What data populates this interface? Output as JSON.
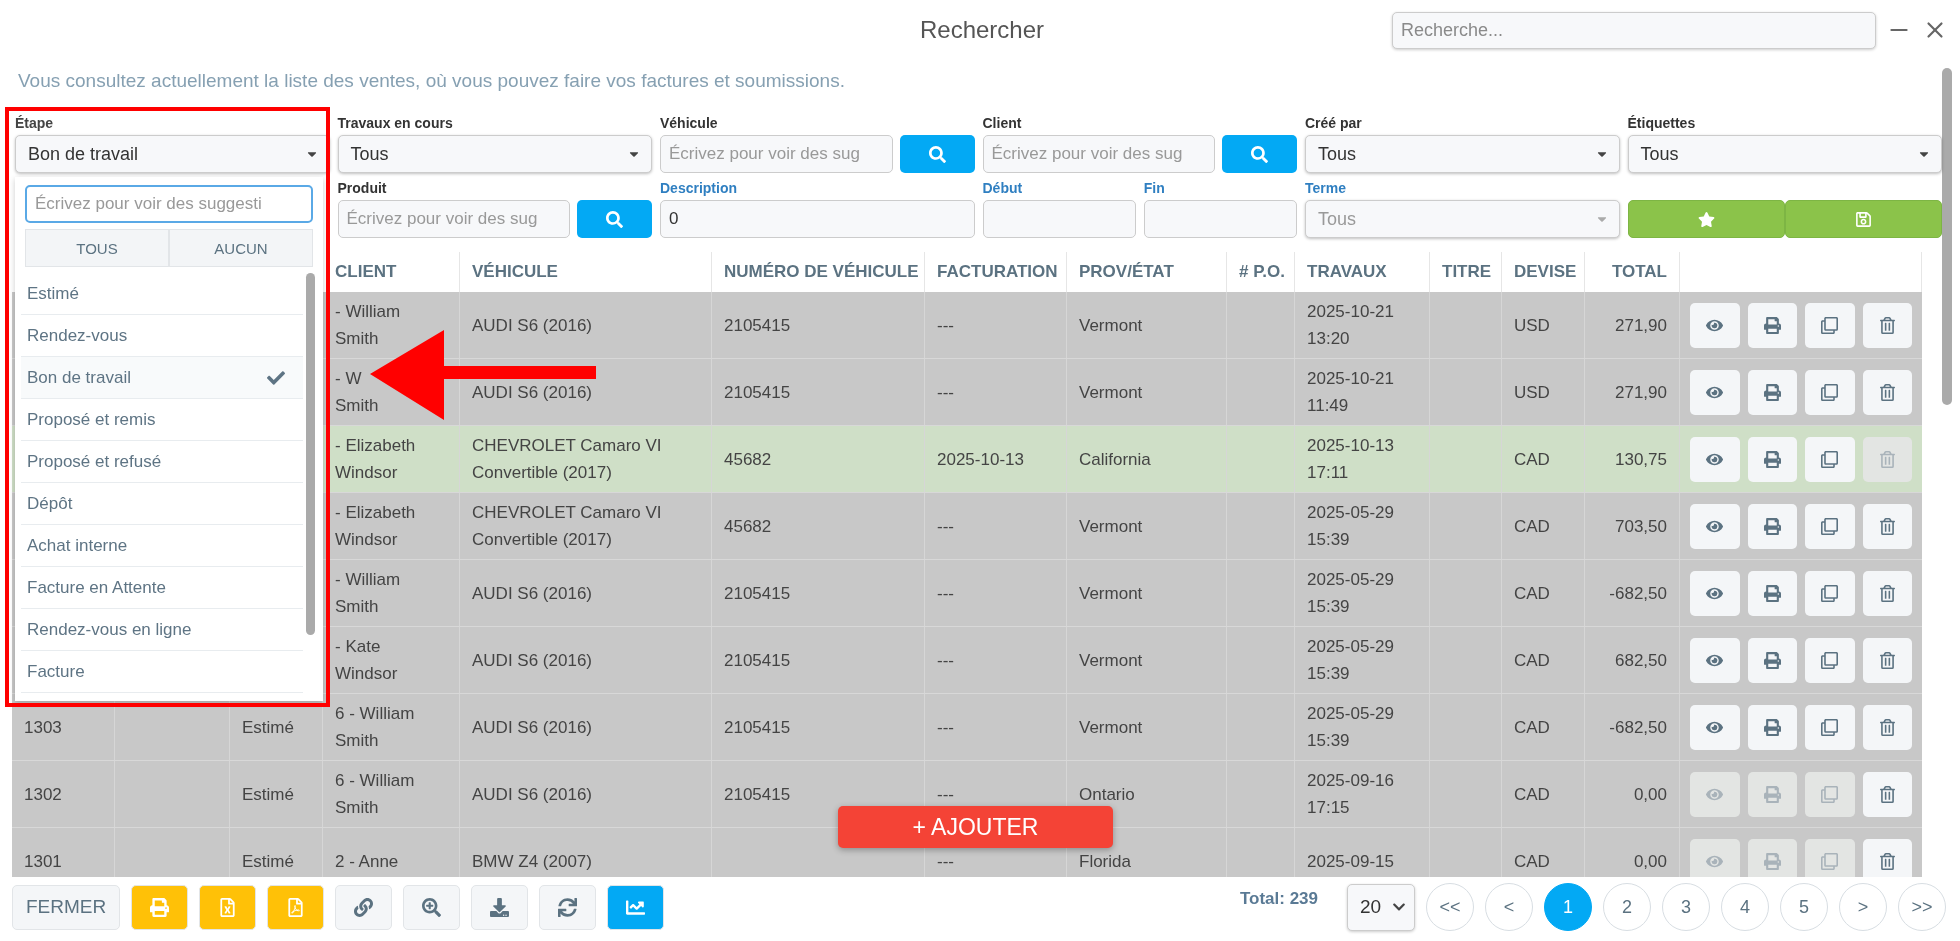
{
  "window": {
    "title": "Rechercher",
    "search": {
      "placeholder": "Recherche..."
    }
  },
  "intro": "Vous consultez actuellement la liste des ventes, où vous pouvez faire vos factures et soumissions.",
  "stage": {
    "label": "Étape",
    "value": "Bon de travail",
    "expanded": true,
    "search_placeholder": "Écrivez pour voir des suggesti",
    "buttons": [
      "TOUS",
      "AUCUN"
    ],
    "options": [
      {
        "label": "Estimé",
        "selected": false
      },
      {
        "label": "Rendez-vous",
        "selected": false
      },
      {
        "label": "Bon de travail",
        "selected": true
      },
      {
        "label": "Proposé et remis",
        "selected": false
      },
      {
        "label": "Proposé et refusé",
        "selected": false
      },
      {
        "label": "Dépôt",
        "selected": false
      },
      {
        "label": "Achat interne",
        "selected": false
      },
      {
        "label": "Facture en Attente",
        "selected": false
      },
      {
        "label": "Rendez-vous en ligne",
        "selected": false
      },
      {
        "label": "Facture",
        "selected": false
      }
    ]
  },
  "filters": [
    [
      {
        "kind": "select",
        "label": "Travaux en cours",
        "value": "Tous",
        "disabled": false,
        "color": "#333333"
      },
      {
        "kind": "search",
        "label": "Véhicule",
        "placeholder": "Écrivez pour voir des sug",
        "color": "#333333"
      },
      {
        "kind": "search",
        "label": "Client",
        "placeholder": "Écrivez pour voir des sug",
        "color": "#333333"
      },
      {
        "kind": "select",
        "label": "Créé par",
        "value": "Tous",
        "disabled": false,
        "color": "#333333"
      },
      {
        "kind": "select",
        "label": "Étiquettes",
        "value": "Tous",
        "disabled": false,
        "color": "#333333"
      }
    ],
    [
      {
        "kind": "search",
        "label": "Produit",
        "placeholder": "Écrivez pour voir des sug",
        "color": "#333333"
      },
      {
        "kind": "text",
        "label": "Description",
        "value": "0",
        "color": "#2f7fc1"
      },
      {
        "kind": "date",
        "label": "Début",
        "color": "#2f7fc1"
      },
      {
        "kind": "date",
        "label": "Fin",
        "color": "#2f7fc1"
      },
      {
        "kind": "select",
        "label": "Terme",
        "value": "Tous",
        "disabled": true,
        "color": "#2f7fc1"
      },
      {
        "kind": "button-pair"
      }
    ]
  ],
  "table": {
    "columns": [
      "CLIENT",
      "VÉHICULE",
      "NUMÉRO DE VÉHICULE",
      "FACTURATION",
      "PROV/ÉTAT",
      "# P.O.",
      "TRAVAUX",
      "TITRE",
      "DEVISE",
      "TOTAL"
    ],
    "rows": [
      {
        "client": [
          "- William",
          "Smith"
        ],
        "vehicle": "AUDI S6 (2016)",
        "vehicle_number": "2105415",
        "billing": "---",
        "province": "Vermont",
        "work": [
          "2025-10-21",
          "13:20"
        ],
        "currency": "USD",
        "total": "271,90",
        "highlighted": false,
        "actions": [
          {
            "kind": "view",
            "disabled": false
          },
          {
            "kind": "print",
            "disabled": false
          },
          {
            "kind": "copy",
            "disabled": false
          },
          {
            "kind": "delete",
            "disabled": false
          }
        ]
      },
      {
        "client": [
          "- W",
          "Smith"
        ],
        "vehicle": "AUDI S6 (2016)",
        "vehicle_number": "2105415",
        "billing": "---",
        "province": "Vermont",
        "work": [
          "2025-10-21",
          "11:49"
        ],
        "currency": "USD",
        "total": "271,90",
        "highlighted": false,
        "actions": [
          {
            "kind": "view",
            "disabled": false
          },
          {
            "kind": "print",
            "disabled": false
          },
          {
            "kind": "copy",
            "disabled": false
          },
          {
            "kind": "delete",
            "disabled": false
          }
        ]
      },
      {
        "client": [
          "- Elizabeth",
          "Windsor"
        ],
        "vehicle": "CHEVROLET Camaro VI Convertible (2017)",
        "vehicle_number": "45682",
        "billing": "2025-10-13",
        "province": "California",
        "work": [
          "2025-10-13",
          "17:11"
        ],
        "currency": "CAD",
        "total": "130,75",
        "highlighted": true,
        "actions": [
          {
            "kind": "view",
            "disabled": false
          },
          {
            "kind": "print",
            "disabled": false
          },
          {
            "kind": "copy",
            "disabled": false
          },
          {
            "kind": "delete",
            "disabled": true
          }
        ]
      },
      {
        "client": [
          "- Elizabeth",
          "Windsor"
        ],
        "vehicle": "CHEVROLET Camaro VI Convertible (2017)",
        "vehicle_number": "45682",
        "billing": "---",
        "province": "Vermont",
        "work": [
          "2025-05-29",
          "15:39"
        ],
        "currency": "CAD",
        "total": "703,50",
        "highlighted": false,
        "actions": [
          {
            "kind": "view",
            "disabled": false
          },
          {
            "kind": "print",
            "disabled": false
          },
          {
            "kind": "copy",
            "disabled": false
          },
          {
            "kind": "delete",
            "disabled": false
          }
        ]
      },
      {
        "client": [
          "- William",
          "Smith"
        ],
        "vehicle": "AUDI S6 (2016)",
        "vehicle_number": "2105415",
        "billing": "---",
        "province": "Vermont",
        "work": [
          "2025-05-29",
          "15:39"
        ],
        "currency": "CAD",
        "total": "-682,50",
        "highlighted": false,
        "actions": [
          {
            "kind": "view",
            "disabled": false
          },
          {
            "kind": "print",
            "disabled": false
          },
          {
            "kind": "copy",
            "disabled": false
          },
          {
            "kind": "delete",
            "disabled": false
          }
        ]
      },
      {
        "client": [
          "- Kate",
          "Windsor"
        ],
        "vehicle": "AUDI S6 (2016)",
        "vehicle_number": "2105415",
        "billing": "---",
        "province": "Vermont",
        "work": [
          "2025-05-29",
          "15:39"
        ],
        "currency": "CAD",
        "total": "682,50",
        "highlighted": false,
        "actions": [
          {
            "kind": "view",
            "disabled": false
          },
          {
            "kind": "print",
            "disabled": false
          },
          {
            "kind": "copy",
            "disabled": false
          },
          {
            "kind": "delete",
            "disabled": false
          }
        ]
      },
      {
        "number": "1303",
        "stage": "Estimé",
        "client": [
          "6 - William",
          "Smith"
        ],
        "vehicle": "AUDI S6 (2016)",
        "vehicle_number": "2105415",
        "billing": "---",
        "province": "Vermont",
        "work": [
          "2025-05-29",
          "15:39"
        ],
        "currency": "CAD",
        "total": "-682,50",
        "highlighted": false,
        "actions": [
          {
            "kind": "view",
            "disabled": false
          },
          {
            "kind": "print",
            "disabled": false
          },
          {
            "kind": "copy",
            "disabled": false
          },
          {
            "kind": "delete",
            "disabled": false
          }
        ]
      },
      {
        "number": "1302",
        "stage": "Estimé",
        "client": [
          "6 - William",
          "Smith"
        ],
        "vehicle": "AUDI S6 (2016)",
        "vehicle_number": "2105415",
        "billing": "---",
        "province": "Ontario",
        "work": [
          "2025-09-16",
          "17:15"
        ],
        "currency": "CAD",
        "total": "0,00",
        "highlighted": false,
        "actions": [
          {
            "kind": "view",
            "disabled": true
          },
          {
            "kind": "print",
            "disabled": true
          },
          {
            "kind": "copy",
            "disabled": true
          },
          {
            "kind": "delete",
            "disabled": false
          }
        ]
      },
      {
        "number": "1301",
        "stage": "Estimé",
        "client": [
          "2 - Anne"
        ],
        "vehicle": "BMW Z4 (2007)",
        "billing": "---",
        "province": "Florida",
        "work": [
          "2025-09-15"
        ],
        "currency": "CAD",
        "total": "0,00",
        "highlighted": false,
        "actions": [
          {
            "kind": "view",
            "disabled": true
          },
          {
            "kind": "print",
            "disabled": true
          },
          {
            "kind": "copy",
            "disabled": true
          },
          {
            "kind": "delete",
            "disabled": false
          }
        ]
      }
    ]
  },
  "add_button": "+ AJOUTER",
  "toolbar": [
    {
      "kind": "close",
      "label": "FERMER",
      "color": "#f4f6f8"
    },
    {
      "kind": "print",
      "color": "#ffc107"
    },
    {
      "kind": "excel",
      "color": "#ffc107"
    },
    {
      "kind": "pdf",
      "color": "#ffc107"
    },
    {
      "kind": "link",
      "color": "#f4f6f8"
    },
    {
      "kind": "zoom",
      "color": "#f4f6f8"
    },
    {
      "kind": "download",
      "color": "#f4f6f8"
    },
    {
      "kind": "refresh",
      "color": "#f4f6f8"
    },
    {
      "kind": "chart",
      "color": "#03a9f4"
    }
  ],
  "total": "Total: 239",
  "page_size": "20",
  "pagination": [
    {
      "label": "<<",
      "selected": false
    },
    {
      "label": "<",
      "selected": false
    },
    {
      "label": "1",
      "selected": true
    },
    {
      "label": "2",
      "selected": false
    },
    {
      "label": "3",
      "selected": false
    },
    {
      "label": "4",
      "selected": false
    },
    {
      "label": "5",
      "selected": false
    },
    {
      "label": ">",
      "selected": false
    },
    {
      "label": ">>",
      "selected": false
    }
  ]
}
